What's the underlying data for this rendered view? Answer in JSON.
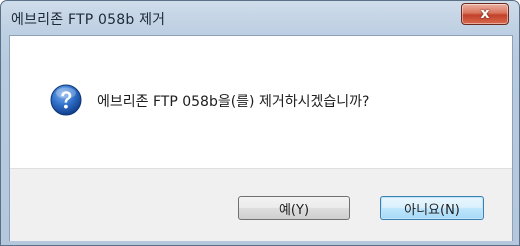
{
  "window": {
    "title": "에브리존 FTP 058b 제거",
    "close_label": "x"
  },
  "dialog": {
    "icon": "question-icon",
    "message": "에브리존 FTP 058b을(를) 제거하시겠습니까?"
  },
  "buttons": {
    "yes_label": "예(Y)",
    "no_label": "아니요(N)"
  },
  "colors": {
    "titlebar": "#bed0e3",
    "close_button": "#c2412b",
    "button_bar": "#f0f0f0",
    "icon_blue": "#1f5fb8"
  }
}
